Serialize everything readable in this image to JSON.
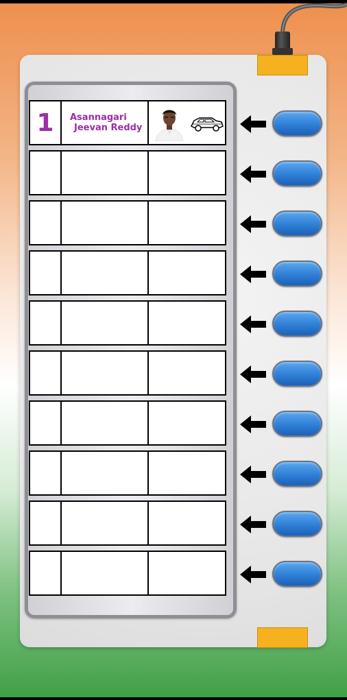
{
  "candidates": [
    {
      "number": "1",
      "name_line1": "Asannagari",
      "name_line2": "Jeevan Reddy",
      "photo_icon": "candidate-photo",
      "symbol_icon": "car-icon"
    },
    {
      "number": "",
      "name_line1": "",
      "name_line2": ""
    },
    {
      "number": "",
      "name_line1": "",
      "name_line2": ""
    },
    {
      "number": "",
      "name_line1": "",
      "name_line2": ""
    },
    {
      "number": "",
      "name_line1": "",
      "name_line2": ""
    },
    {
      "number": "",
      "name_line1": "",
      "name_line2": ""
    },
    {
      "number": "",
      "name_line1": "",
      "name_line2": ""
    },
    {
      "number": "",
      "name_line1": "",
      "name_line2": ""
    },
    {
      "number": "",
      "name_line1": "",
      "name_line2": ""
    },
    {
      "number": "",
      "name_line1": "",
      "name_line2": ""
    }
  ],
  "colors": {
    "candidate_text": "#9b2fa5",
    "vote_button": "#2f7fd6",
    "tab": "#f5b120"
  },
  "icons": {
    "arrow": "arrow-left-icon",
    "button": "vote-button"
  }
}
